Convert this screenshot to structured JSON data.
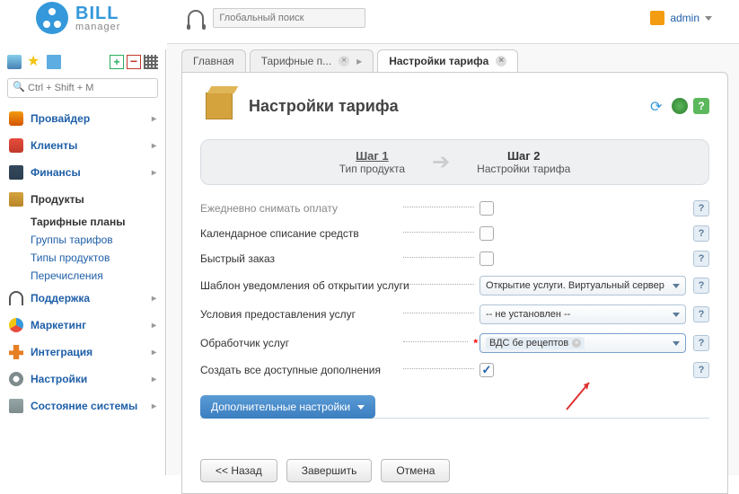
{
  "header": {
    "logo_main": "BILL",
    "logo_sub": "manager",
    "global_search_placeholder": "Глобальный поиск",
    "admin_label": "admin"
  },
  "sidebar": {
    "search_placeholder": "Ctrl + Shift + M",
    "items": [
      {
        "label": "Провайдер",
        "id": "provider"
      },
      {
        "label": "Клиенты",
        "id": "clients"
      },
      {
        "label": "Финансы",
        "id": "finance"
      },
      {
        "label": "Продукты",
        "id": "products",
        "active": true
      },
      {
        "label": "Поддержка",
        "id": "support"
      },
      {
        "label": "Маркетинг",
        "id": "marketing"
      },
      {
        "label": "Интеграция",
        "id": "integration"
      },
      {
        "label": "Настройки",
        "id": "settings"
      },
      {
        "label": "Состояние системы",
        "id": "system"
      }
    ],
    "sub": {
      "current": "Тарифные планы",
      "i1": "Группы тарифов",
      "i2": "Типы продуктов",
      "i3": "Перечисления"
    }
  },
  "tabs": {
    "t0": "Главная",
    "t1": "Тарифные п...",
    "t2": "Настройки тарифа"
  },
  "page": {
    "title": "Настройки тарифа",
    "step1_title": "Шаг 1",
    "step1_sub": "Тип продукта",
    "step2_title": "Шаг 2",
    "step2_sub": "Настройки тарифа"
  },
  "form": {
    "r0_label": "Ежедневно снимать оплату",
    "r1_label": "Календарное списание средств",
    "r2_label": "Быстрый заказ",
    "r3_label": "Шаблон уведомления об открытии услуги",
    "r3_value": "Открытие услуги. Виртуальный сервер",
    "r4_label": "Условия предоставления услуг",
    "r4_value": "-- не установлен --",
    "r5_label": "Обработчик услуг",
    "r5_value": "ВДС бе рецептов",
    "r6_label": "Создать все доступные дополнения"
  },
  "collapsible": {
    "title": "Дополнительные настройки"
  },
  "buttons": {
    "back": "<< Назад",
    "finish": "Завершить",
    "cancel": "Отмена"
  }
}
